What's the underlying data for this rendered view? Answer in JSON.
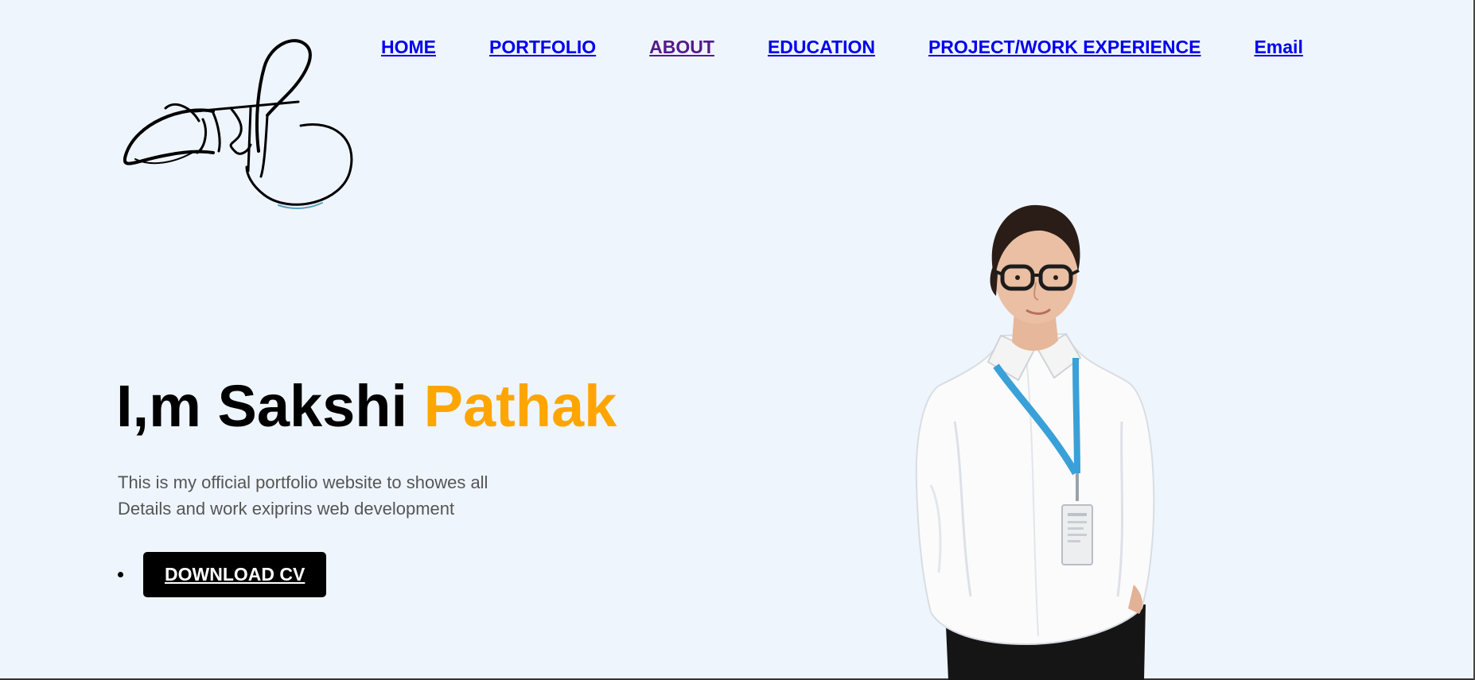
{
  "logo": {
    "alt": "सांक्षी signature logo",
    "ink_color": "#000000"
  },
  "nav": {
    "items": [
      {
        "label": "HOME",
        "visited": false
      },
      {
        "label": "PORTFOLIO",
        "visited": false
      },
      {
        "label": "ABOUT",
        "visited": true
      },
      {
        "label": "EDUCATION",
        "visited": false
      },
      {
        "label": "PROJECT/WORK EXPERIENCE",
        "visited": false
      },
      {
        "label": "Email",
        "visited": false
      }
    ],
    "link_color": "#0000ee",
    "visited_color": "#551a8b"
  },
  "hero": {
    "title_prefix": "I,m Sakshi",
    "title_highlight": "Pathak",
    "highlight_color": "#ffa500",
    "description_line1": "This is my official portfolio website to showes all",
    "description_line2": "Details and work exiprins web development",
    "cv_button_label": "DOWNLOAD CV"
  },
  "portrait": {
    "alt": "Portrait photo of a woman in a white shirt wearing glasses and a blue ID lanyard"
  },
  "colors": {
    "background": "#eff5fd",
    "text": "#000000",
    "muted_text": "#555555"
  }
}
